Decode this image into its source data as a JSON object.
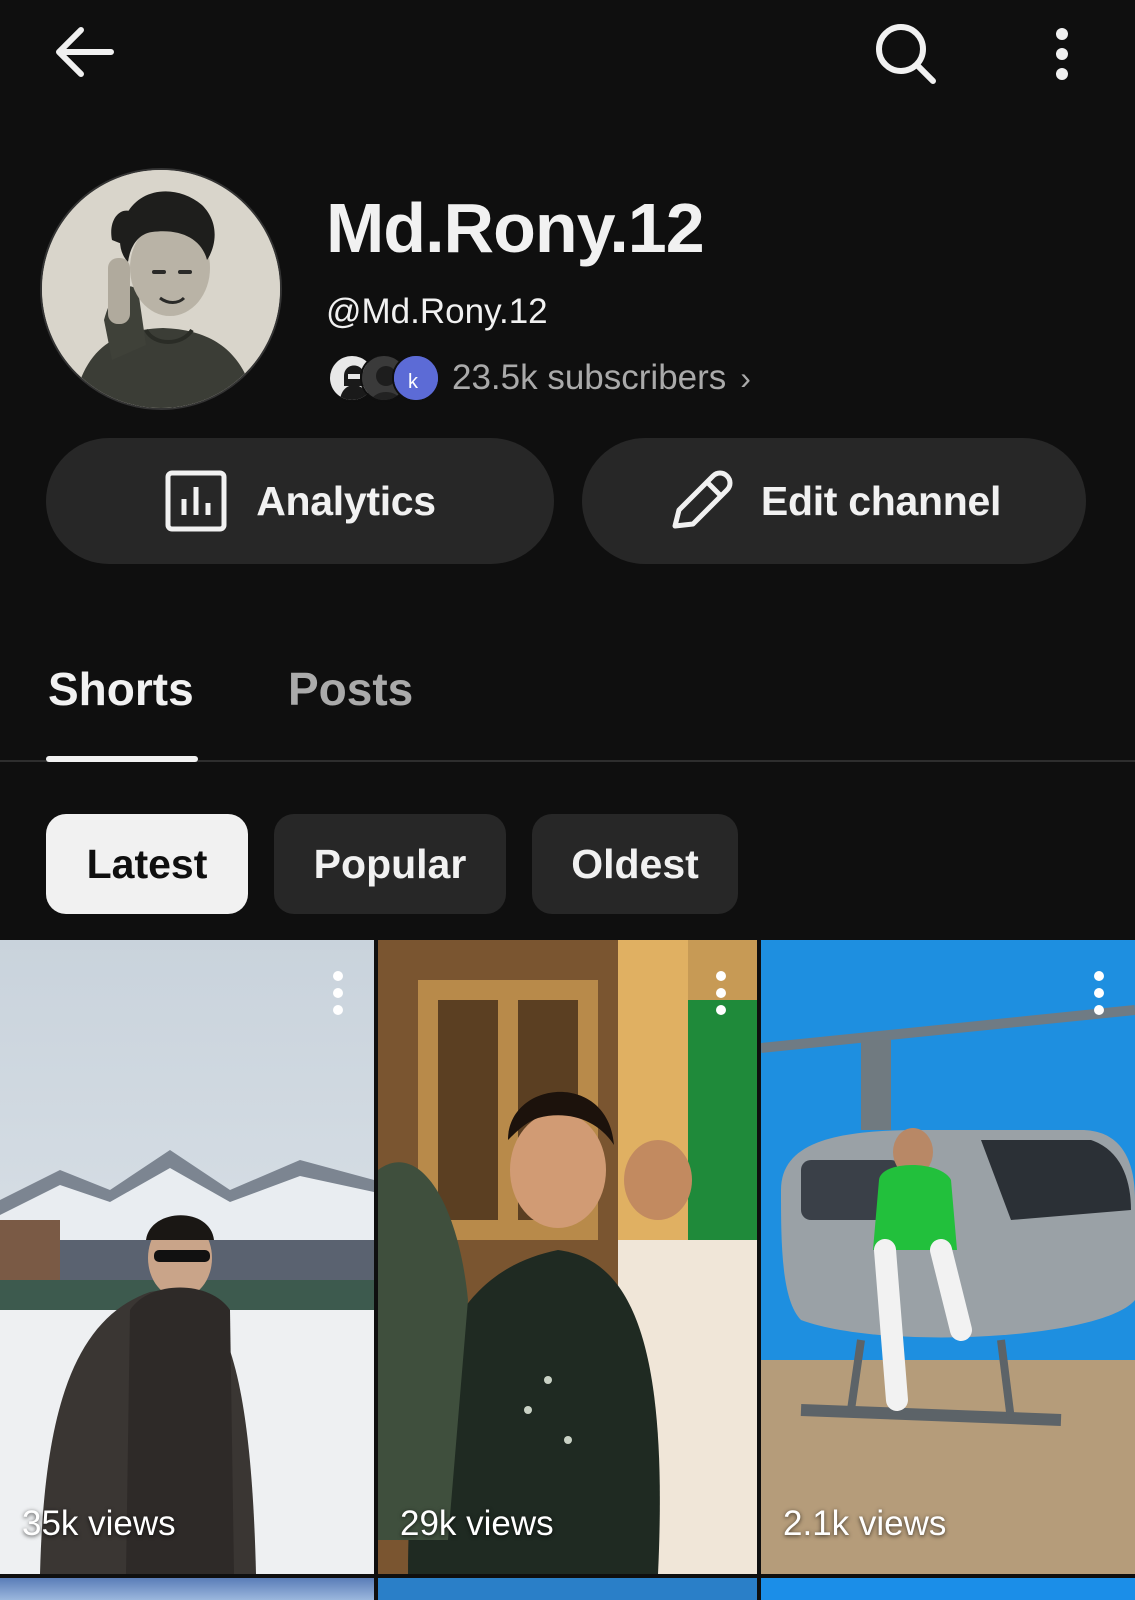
{
  "header": {
    "back_icon": "arrow-left-icon",
    "search_icon": "search-icon",
    "more_icon": "more-vert-icon"
  },
  "channel": {
    "name": "Md.Rony.12",
    "handle": "@Md.Rony.12",
    "subscribers": "23.5k subscribers",
    "subscribers_chevron": "›"
  },
  "actions": {
    "analytics_label": "Analytics",
    "edit_label": "Edit channel"
  },
  "tabs": [
    {
      "label": "Shorts",
      "active": true
    },
    {
      "label": "Posts",
      "active": false
    }
  ],
  "filters": [
    {
      "label": "Latest",
      "selected": true
    },
    {
      "label": "Popular",
      "selected": false
    },
    {
      "label": "Oldest",
      "selected": false
    }
  ],
  "shorts": [
    {
      "views": "35k views"
    },
    {
      "views": "29k views"
    },
    {
      "views": "2.1k views"
    }
  ],
  "colors": {
    "background": "#0f0f0f",
    "surface": "#272727",
    "text": "#f1f1f1",
    "secondary_text": "#aaaaaa"
  }
}
